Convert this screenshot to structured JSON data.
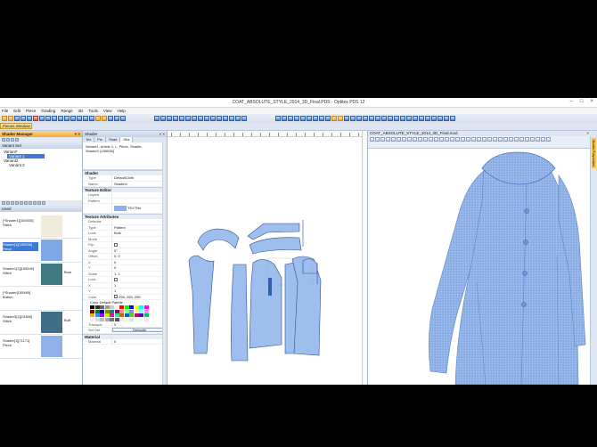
{
  "window": {
    "title": "COAT_ABSOLUTE_STYLE_2014_3D_Final.PDS - Optitex PDS 12"
  },
  "menu": [
    "File",
    "Edit",
    "Piece",
    "Grading",
    "Range",
    "3D",
    "Tools",
    "View",
    "Help"
  ],
  "pieces_window_label": "Pieces Window",
  "shader_manager": {
    "title": "Shader Manager",
    "variant_set": {
      "header": "Variant Set",
      "items": [
        "Variant*",
        "Variant 1",
        "Variant2",
        "Variant 3"
      ]
    },
    "used_label": "Used",
    "shaders": [
      {
        "label": "[*Shader1][150035] Stitch",
        "color": "#f2ebdc",
        "extra": ""
      },
      {
        "label": "Shader[1][150036] Piece",
        "color": "#7fa8e6",
        "extra": ""
      },
      {
        "label": "Shader1[1][155540] Stitch",
        "color": "#3f7a82",
        "extra": "Bom"
      },
      {
        "label": "[*Shader[155489] Button",
        "color": "#ffffff",
        "extra": ""
      },
      {
        "label": "Shader3[1][23388] Stitch",
        "color": "#3f6f86",
        "extra": "Butt"
      },
      {
        "label": "Shader[1][71171] Piece",
        "color": "#8fb1e8",
        "extra": ""
      }
    ]
  },
  "shader_panel": {
    "title": "Shader",
    "tabs": [
      "Tex",
      "Pie",
      "Shad",
      "Sha"
    ],
    "info": [
      "Variant1, Article 1, L, Piece, Shader,",
      "Shader1 [155036]"
    ],
    "sections": {
      "shader": "Shader",
      "texture_editor": "Texture Editor",
      "texture_attributes": "Texture Attributes",
      "material": "Material"
    },
    "shader_props": [
      {
        "key": "Type",
        "value": "DefaultCloth"
      },
      {
        "key": "Name",
        "value": "Shader1"
      }
    ],
    "texture_props": [
      {
        "key": "Layers",
        "value": ""
      },
      {
        "key": "Pattern",
        "value": ""
      }
    ],
    "layer_value": "TEXTNo",
    "attributes": [
      {
        "key": "Defaults",
        "value": ""
      },
      {
        "key": "Type",
        "value": "Pattern"
      },
      {
        "key": "Look",
        "value": "Bulk"
      },
      {
        "key": "Mode",
        "value": ""
      },
      {
        "key": "Flip",
        "value": ""
      },
      {
        "key": "Angle",
        "value": "0°"
      },
      {
        "key": "Offset",
        "value": "0, 0"
      },
      {
        "key": "X",
        "value": "0"
      },
      {
        "key": "Y",
        "value": "0"
      },
      {
        "key": "Scale",
        "value": "1, 1"
      },
      {
        "key": "Lock",
        "value": ""
      },
      {
        "key": "X",
        "value": "1"
      },
      {
        "key": "Y",
        "value": "1"
      }
    ],
    "color_key": "Color",
    "color_value": "255, 255, 255",
    "palette_label": "Color Default Palette",
    "transparency": {
      "key": "Transpar",
      "value": "0"
    },
    "setdefault": {
      "key": "Set Def",
      "value": "Defaults"
    },
    "material_prop": {
      "key": "Material",
      "value": "0"
    }
  },
  "colors": {
    "accent": "#f4a93b",
    "garment": "#8fb1e8",
    "piece_fill": "#9ebfee",
    "piece_stroke": "#2b4f8f"
  },
  "view3d": {
    "title": "COAT_ABSOLUTE_STYLE_2014_3D_Final.mod",
    "side_label": "Model Properties"
  }
}
